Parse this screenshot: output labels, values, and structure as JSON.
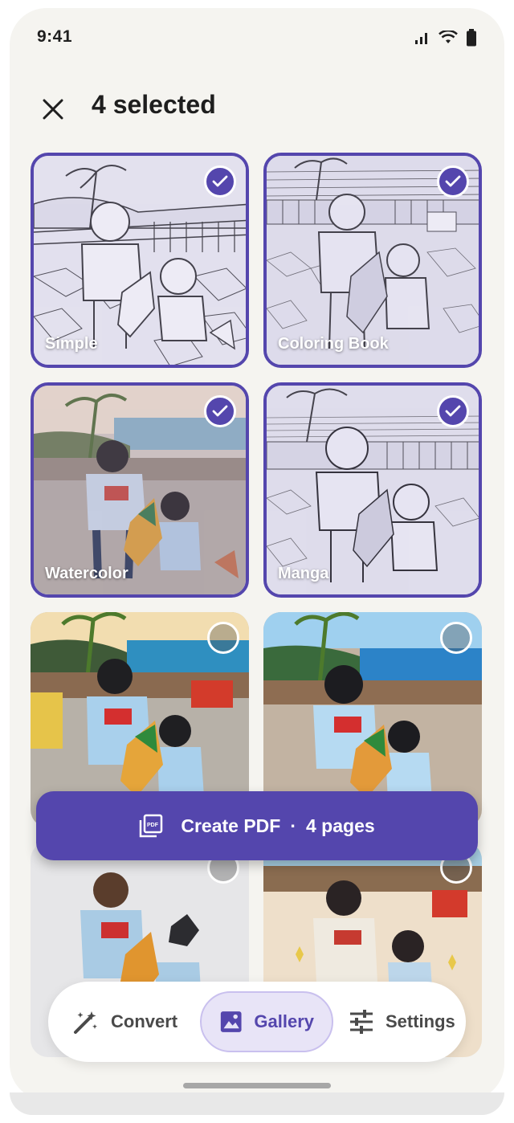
{
  "status_bar": {
    "time": "9:41"
  },
  "header": {
    "title": "4 selected"
  },
  "tiles": [
    {
      "label": "Simple",
      "selected": true
    },
    {
      "label": "Coloring Book",
      "selected": true
    },
    {
      "label": "Watercolor",
      "selected": true
    },
    {
      "label": "Manga",
      "selected": true
    },
    {
      "label": "",
      "selected": false
    },
    {
      "label": "",
      "selected": false
    },
    {
      "label": "",
      "selected": false
    },
    {
      "label": "",
      "selected": false
    }
  ],
  "fab": {
    "label": "Create PDF",
    "separator": "·",
    "pages": "4 pages"
  },
  "nav": {
    "items": [
      {
        "label": "Convert",
        "icon": "magic-wand-icon"
      },
      {
        "label": "Gallery",
        "icon": "image-icon",
        "active": true
      },
      {
        "label": "Settings",
        "icon": "sliders-icon"
      }
    ]
  },
  "colors": {
    "accent": "#5446ad",
    "background": "#f5f4f0",
    "active_pill": "#e8e4f7"
  }
}
